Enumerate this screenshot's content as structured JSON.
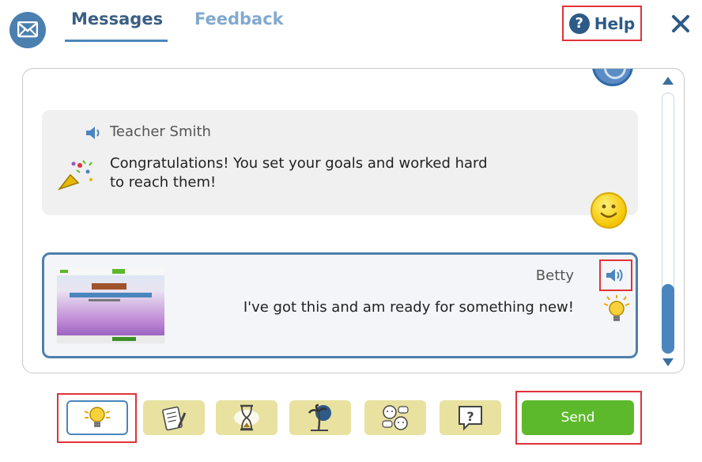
{
  "header": {
    "tabs": [
      {
        "label": "Messages",
        "active": true
      },
      {
        "label": "Feedback",
        "active": false
      }
    ],
    "help_label": "Help"
  },
  "messages": [
    {
      "sender": "Teacher Smith",
      "text": "Congratulations! You set your goals and worked hard to reach them!",
      "icons": [
        "speaker-icon",
        "confetti-icon",
        "smiley-icon"
      ]
    },
    {
      "sender": "Betty",
      "text": "I've got this and am ready for something new!",
      "icons": [
        "speaker-icon",
        "lightbulb-icon"
      ],
      "has_screenshot": true
    }
  ],
  "toolbar": {
    "tools": [
      {
        "icon": "lightbulb-icon",
        "selected": true
      },
      {
        "icon": "notepad-pencil-icon",
        "selected": false
      },
      {
        "icon": "hourglass-icon",
        "selected": false
      },
      {
        "icon": "palm-tree-icon",
        "selected": false
      },
      {
        "icon": "faces-chat-icon",
        "selected": false
      },
      {
        "icon": "question-bubble-icon",
        "selected": false
      }
    ],
    "send_label": "Send"
  },
  "colors": {
    "accent": "#4a86bd",
    "send": "#5cb92b",
    "tool_bg": "#e8e1a0",
    "highlight": "#e0333a"
  }
}
